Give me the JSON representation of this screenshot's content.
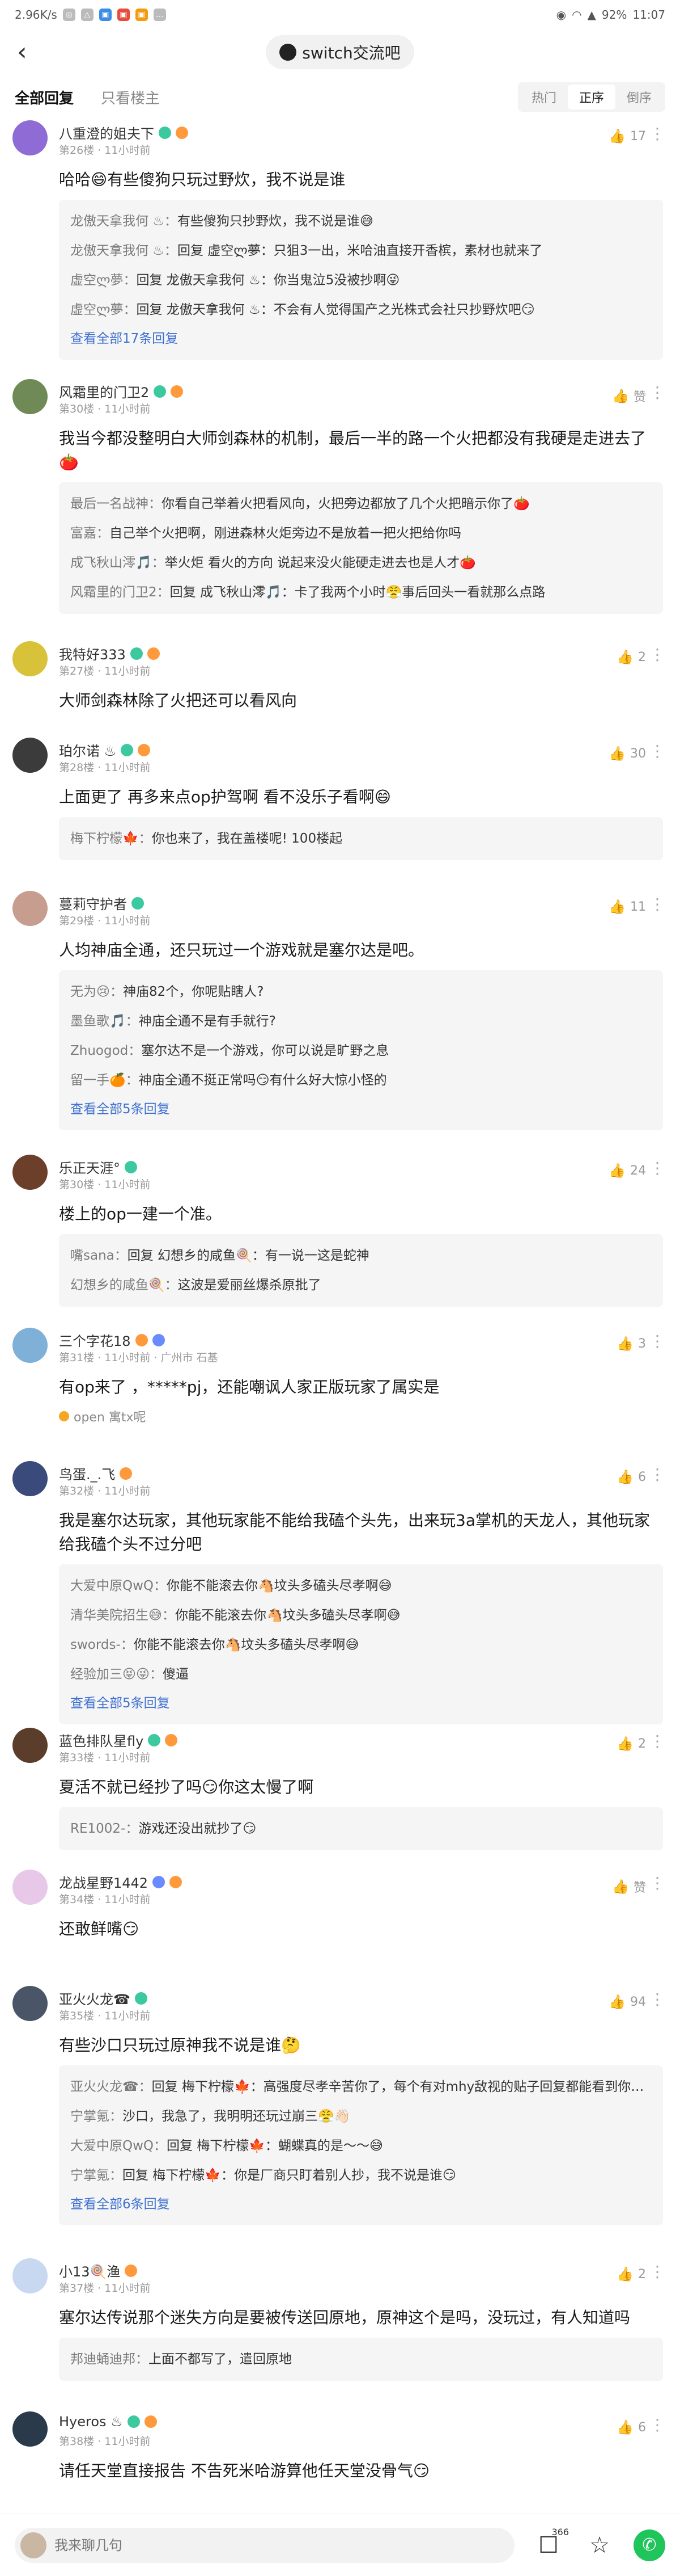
{
  "status_bar": {
    "speed": "2.96K/s",
    "battery": "92%",
    "time": "11:07"
  },
  "header": {
    "title": "switch交流吧"
  },
  "tabs": {
    "all": "全部回复",
    "op_only": "只看楼主"
  },
  "sort": [
    "热门",
    "正序",
    "倒序"
  ],
  "comments": [
    {
      "user": "八重澄的姐夫下",
      "meta": "第26楼 · 11小时前",
      "likes": "17",
      "avatar_color": "#8f6bd6",
      "badges": [
        "green",
        "orange"
      ],
      "text": "哈哈😄有些傻狗只玩过野炊，我不说是谁",
      "replies": [
        {
          "name": "龙傲天拿我何 ♨：",
          "text": "有些傻狗只抄野炊，我不说是谁😅"
        },
        {
          "name": "龙傲天拿我何 ♨：",
          "text": "回复 虚空ლ夢：只狙3一出，米哈油直接开香槟，素材也就来了"
        },
        {
          "name": "虚空ლ夢：",
          "text": "回复 龙傲天拿我何 ♨：你当鬼泣5没被抄啊😜"
        },
        {
          "name": "虚空ლ夢：",
          "text": "回复 龙傲天拿我何 ♨：不会有人觉得国产之光株式会社只抄野炊吧😏"
        }
      ],
      "view_all": "查看全部17条回复"
    },
    {
      "user": "风霜里的门卫2",
      "meta": "第30楼 · 11小时前",
      "likes": "赞",
      "avatar_color": "#6f8a56",
      "badges": [
        "green",
        "orange"
      ],
      "text": "我当今都没整明白大师剑森林的机制，最后一半的路一个火把都没有我硬是走进去了🍅",
      "replies": [
        {
          "name": "最后一名战神：",
          "text": "你看自己举着火把看风向，火把旁边都放了几个火把暗示你了🍅"
        },
        {
          "name": "富嘉：",
          "text": "自己举个火把啊，刚进森林火炬旁边不是放着一把火把给你吗"
        },
        {
          "name": "成飞秋山澪🎵：",
          "text": "举火炬 看火的方向 说起来没火能硬走进去也是人才🍅"
        },
        {
          "name": "风霜里的门卫2：",
          "text": "回复 成飞秋山澪🎵：卡了我两个小时😤事后回头一看就那么点路"
        }
      ],
      "view_all": ""
    },
    {
      "user": "我特好333",
      "meta": "第27楼 · 11小时前",
      "likes": "2",
      "avatar_color": "#d8c23a",
      "badges": [
        "green",
        "orange"
      ],
      "text": "大师剑森林除了火把还可以看风向",
      "replies": [],
      "view_all": ""
    },
    {
      "user": "珀尔诺 ♨",
      "meta": "第28楼 · 11小时前",
      "likes": "30",
      "avatar_color": "#3b3b3b",
      "badges": [
        "green",
        "orange"
      ],
      "text": "上面更了 再多来点op护驾啊 看不没乐子看啊😄",
      "replies": [
        {
          "name": "梅下柠檬🍁：",
          "text": "你也来了，我在盖楼呢! 100楼起"
        }
      ],
      "view_all": ""
    },
    {
      "user": "蔓莉守护者",
      "meta": "第29楼 · 11小时前",
      "likes": "11",
      "avatar_color": "#c79d8f",
      "badges": [
        "green"
      ],
      "text": "人均神庙全通，还只玩过一个游戏就是塞尔达是吧。",
      "replies": [
        {
          "name": "无为😢：",
          "text": "神庙82个，你呢贴瞎人?"
        },
        {
          "name": "墨鱼歌🎵：",
          "text": "神庙全通不是有手就行?"
        },
        {
          "name": "Zhuogod：",
          "text": "塞尔达不是一个游戏，你可以说是旷野之息"
        },
        {
          "name": "留一手🍊：",
          "text": "神庙全通不挺正常吗😏有什么好大惊小怪的"
        }
      ],
      "view_all": "查看全部5条回复"
    },
    {
      "user": "乐正天涯°",
      "meta": "第30楼 · 11小时前",
      "likes": "24",
      "avatar_color": "#6b3f2a",
      "badges": [
        "green"
      ],
      "text": "楼上的op一建一个准。",
      "replies": [
        {
          "name": "嘴sana：",
          "text": "回复 幻想乡的咸鱼🍭：有一说一这是蛇神"
        },
        {
          "name": "幻想乡的咸鱼🍭：",
          "text": "这波是爱丽丝爆杀原批了"
        }
      ],
      "view_all": ""
    },
    {
      "user": "三个字花18",
      "meta": "第31楼 · 11小时前 · 广州市 石基",
      "likes": "3",
      "avatar_color": "#7fb0d8",
      "badges": [
        "orange",
        "blue"
      ],
      "text": "有op来了  ，*****pj，还能嘲讽人家正版玩家了属实是",
      "replies": [],
      "view_all": "",
      "extra": "open 寓tx呢"
    },
    {
      "user": "鸟蛋._.飞",
      "meta": "第32楼 · 11小时前",
      "likes": "6",
      "avatar_color": "#3a4a7a",
      "badges": [
        "orange"
      ],
      "text": "我是塞尔达玩家，其他玩家能不能给我磕个头先，出来玩3a掌机的天龙人，其他玩家给我磕个头不过分吧",
      "replies": [
        {
          "name": "大爱中原QwQ：",
          "text": "你能不能滚去你🐴坟头多磕头尽孝啊😅"
        },
        {
          "name": "清华美院招生😅：",
          "text": "你能不能滚去你🐴坟头多磕头尽孝啊😅"
        },
        {
          "name": "swords-：",
          "text": "你能不能滚去你🐴坟头多磕头尽孝啊😅"
        },
        {
          "name": "经验加三😝😜：",
          "text": "傻逼"
        }
      ],
      "view_all": "查看全部5条回复"
    },
    {
      "user": "蓝色排队星fly",
      "meta": "第33楼 · 11小时前",
      "likes": "2",
      "avatar_color": "#5a3d2b",
      "badges": [
        "green",
        "orange"
      ],
      "text": "夏活不就已经抄了吗😏你这太慢了啊",
      "replies": [
        {
          "name": "RE1002-：",
          "text": "游戏还没出就抄了😏"
        }
      ],
      "view_all": ""
    },
    {
      "user": "龙战星野1442",
      "meta": "第34楼 · 11小时前",
      "likes": "赞",
      "avatar_color": "#e8c8e8",
      "badges": [
        "blue",
        "orange"
      ],
      "text": "还敢鲜嘴😏",
      "replies": [],
      "view_all": ""
    },
    {
      "user": "亚火火龙☎",
      "meta": "第35楼 · 11小时前",
      "likes": "94",
      "avatar_color": "#4a5568",
      "badges": [
        "green"
      ],
      "text": "有些沙口只玩过原神我不说是谁🤔",
      "replies": [
        {
          "name": "亚火火龙☎：",
          "text": "回复 梅下柠檬🍁：高强度尽孝辛苦你了，每个有对mhy敌视的贴子回复都能看到你，浪费这么多时间值得吗😅"
        },
        {
          "name": "宁掌氪：",
          "text": "沙口，我急了，我明明还玩过崩三😤👋🏻"
        },
        {
          "name": "大爱中原QwQ：",
          "text": "回复 梅下柠檬🍁：蝴蝶真的是～～😅"
        },
        {
          "name": "宁掌氪：",
          "text": "回复 梅下柠檬🍁：你是厂商只盯着别人抄，我不说是谁😏"
        }
      ],
      "view_all": "查看全部6条回复"
    },
    {
      "user": "小13🍭渔",
      "meta": "第37楼 · 11小时前",
      "likes": "2",
      "avatar_color": "#c8d8f0",
      "badges": [
        "orange"
      ],
      "text": "塞尔达传说那个迷失方向是要被传送回原地，原神这个是吗，没玩过，有人知道吗",
      "replies": [
        {
          "name": "邦迪蛹迪邦：",
          "text": "上面不都写了，遣回原地"
        }
      ],
      "view_all": ""
    },
    {
      "user": "Hyeros ♨",
      "meta": "第38楼 · 11小时前",
      "likes": "6",
      "avatar_color": "#2a3a4a",
      "badges": [
        "green",
        "orange"
      ],
      "text": "请任天堂直接报告 不告死米哈游算他任天堂没骨气😏",
      "replies": [],
      "view_all": ""
    }
  ],
  "bottom_bar": {
    "placeholder": "我来聊几句",
    "comment_count": "366"
  }
}
